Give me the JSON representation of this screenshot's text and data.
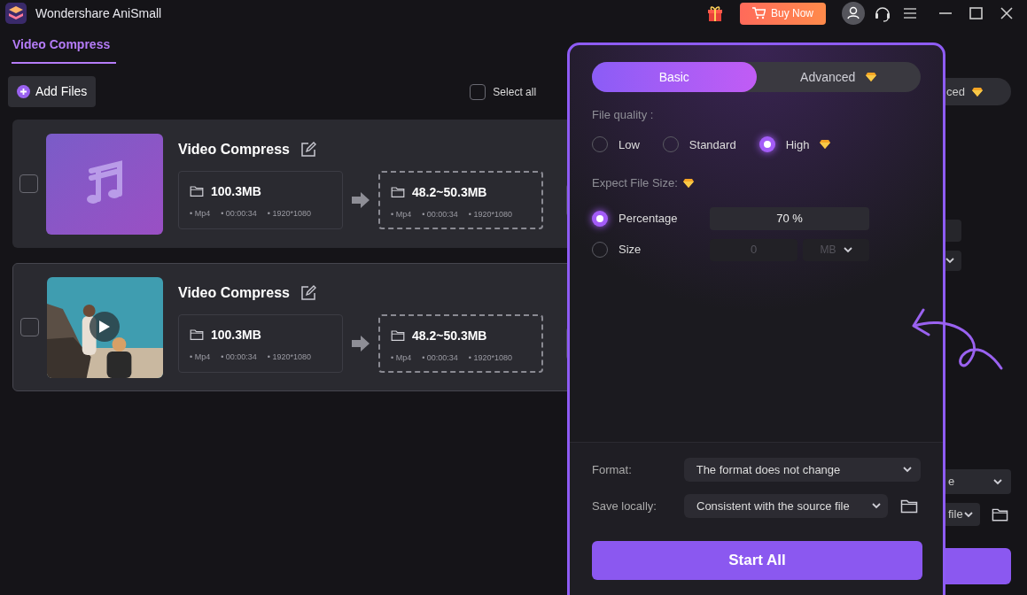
{
  "title_bar": {
    "app_title": "Wondershare AniSmall",
    "buy_button": "Buy Now"
  },
  "tabs": [
    {
      "label": "Video Compress",
      "selected": true
    }
  ],
  "toolbar": {
    "add_files": "Add Files",
    "select_all": {
      "label": "Select all",
      "checked": false
    }
  },
  "files": [
    {
      "kind": "audio",
      "name": "Video Compress",
      "checked": false,
      "source": {
        "size": "100.3MB",
        "format": "• Mp4",
        "duration": "• 00:00:34",
        "resolution": "• 1920*1080"
      },
      "output": {
        "size": "48.2~50.3MB",
        "format": "• Mp4",
        "duration": "• 00:00:34",
        "resolution": "• 1920*1080"
      }
    },
    {
      "kind": "video",
      "name": "Video Compress",
      "checked": false,
      "source": {
        "size": "100.3MB",
        "format": "• Mp4",
        "duration": "• 00:00:34",
        "resolution": "• 1920*1080"
      },
      "output": {
        "size": "48.2~50.3MB",
        "format": "• Mp4",
        "duration": "• 00:00:34",
        "resolution": "• 1920*1080"
      }
    }
  ],
  "background_panel": {
    "tab_fragment": "ced",
    "format_fragment": "e",
    "save_fragment": "file"
  },
  "popup": {
    "tabs": [
      {
        "label": "Basic",
        "selected": true,
        "premium": false
      },
      {
        "label": "Advanced",
        "selected": false,
        "premium": true
      }
    ],
    "quality_label": "File quality :",
    "quality_options": [
      {
        "label": "Low",
        "selected": false,
        "premium": false
      },
      {
        "label": "Standard",
        "selected": false,
        "premium": false
      },
      {
        "label": "High",
        "selected": true,
        "premium": true
      }
    ],
    "size_label": "Expect File Size:",
    "size_options": [
      {
        "kind": "percentage",
        "label": "Percentage",
        "selected": true,
        "value": "70 %"
      },
      {
        "kind": "size",
        "label": "Size",
        "selected": false,
        "value": "0",
        "unit": "MB"
      }
    ],
    "format": {
      "label": "Format:",
      "value": "The format does not change"
    },
    "save": {
      "label": "Save locally:",
      "value": "Consistent with the source file"
    },
    "start_button": "Start All"
  }
}
